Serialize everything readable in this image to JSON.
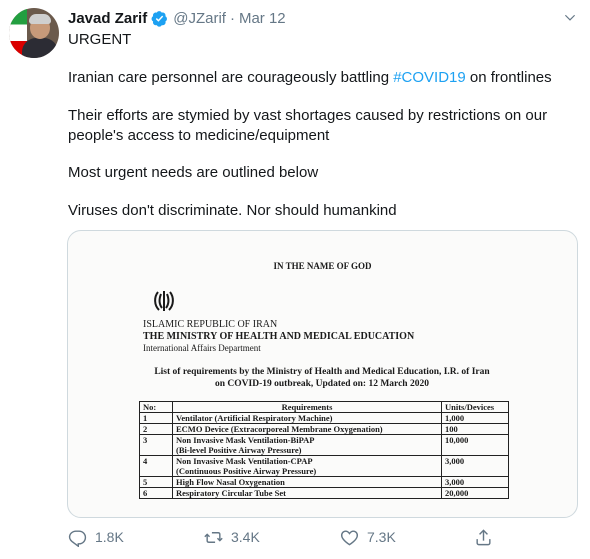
{
  "tweet": {
    "author_name": "Javad Zarif",
    "handle": "@JZarif",
    "separator": "·",
    "date": "Mar 12",
    "headline": "URGENT",
    "line1_pre": "Iranian care personnel are courageously battling ",
    "hashtag": "#COVID19",
    "line1_post": " on frontlines",
    "para2": "Their efforts are stymied by vast shortages caused by restrictions on our people's access to medicine/equipment",
    "para3": "Most urgent needs are outlined below",
    "para4": "Viruses don't discriminate. Nor should humankind"
  },
  "document": {
    "heading": "IN THE NAME OF GOD",
    "republic": "ISLAMIC REPUBLIC OF IRAN",
    "ministry": "THE MINISTRY OF HEALTH AND MEDICAL EDUCATION",
    "department": "International Affairs Department",
    "list_title_1": "List of requirements by the Ministry of Health and Medical Education, I.R. of Iran",
    "list_title_2": "on COVID-19 outbreak, Updated on: 12 March 2020",
    "columns": [
      "No:",
      "Requirements",
      "Units/Devices"
    ],
    "rows": [
      {
        "no": "1",
        "req": "Ventilator (Artificial Respiratory Machine)",
        "units": "1,000"
      },
      {
        "no": "2",
        "req": "ECMO Device (Extracorporeal Membrane Oxygenation)",
        "units": "100"
      },
      {
        "no": "3",
        "req": "Non Invasive Mask Ventilation-BiPAP",
        "req2": "(Bi-level Positive Airway Pressure)",
        "units": "10,000"
      },
      {
        "no": "4",
        "req": "Non Invasive Mask Ventilation-CPAP",
        "req2": "(Continuous Positive Airway Pressure)",
        "units": "3,000"
      },
      {
        "no": "5",
        "req": "High Flow Nasal Oxygenation",
        "units": "3,000"
      },
      {
        "no": "6",
        "req": "Respiratory Circular Tube Set",
        "units": "20,000"
      }
    ]
  },
  "actions": {
    "reply_count": "1.8K",
    "retweet_count": "3.4K",
    "like_count": "7.3K"
  },
  "icons": [
    "verified-badge-icon",
    "caret-down-icon",
    "reply-icon",
    "retweet-icon",
    "like-icon",
    "share-icon"
  ],
  "colors": {
    "link": "#1da1f2",
    "muted": "#657786",
    "text": "#14171a"
  }
}
